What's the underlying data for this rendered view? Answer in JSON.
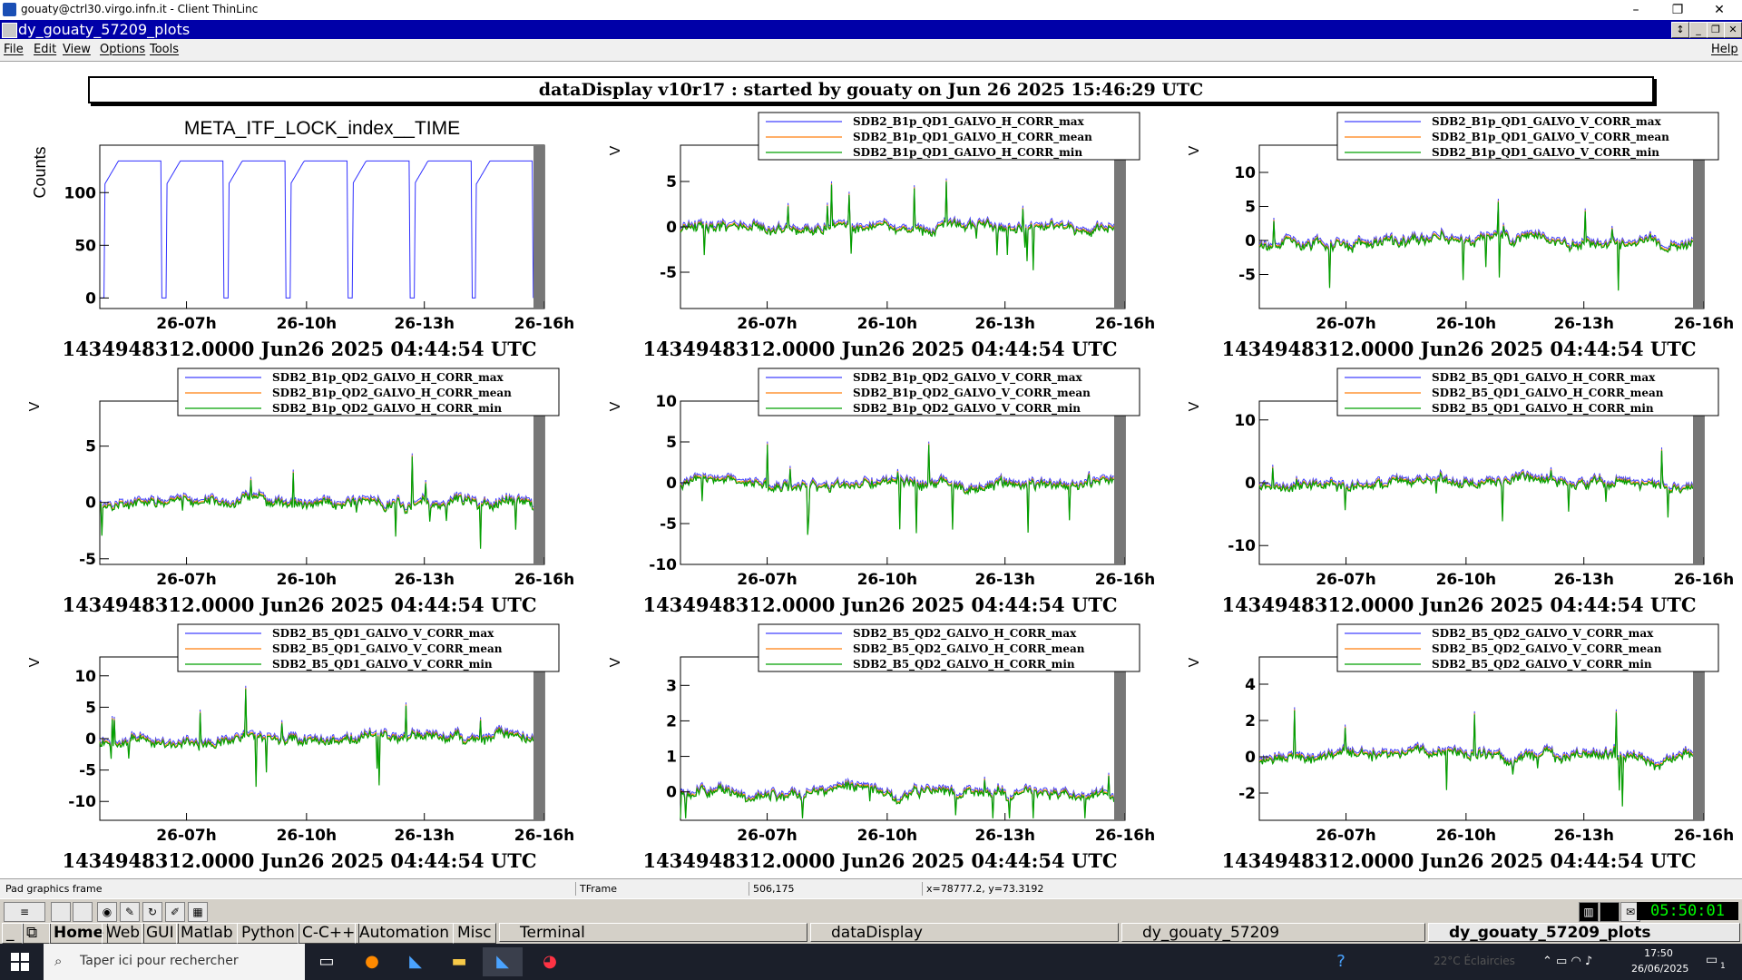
{
  "outer_window": {
    "title": "gouaty@ctrl30.virgo.infn.it - Client ThinLinc",
    "minimize": "–",
    "restore": "❐",
    "close": "✕"
  },
  "inner_window": {
    "title": "dy_gouaty_57209_plots"
  },
  "menu": {
    "file": "File",
    "edit": "Edit",
    "view": "View",
    "options": "Options",
    "tools": "Tools",
    "help": "Help"
  },
  "banner": "dataDisplay v10r17 : started by gouaty on Jun 26 2025 15:46:29 UTC",
  "footer_time": "1434948312.0000 Jun26 2025 04:44:54 UTC",
  "x_ticks": [
    "26-07h",
    "26-10h",
    "26-13h",
    "26-16h"
  ],
  "plots": [
    {
      "title": "META_ITF_LOCK_index__TIME",
      "ylabel": "Counts",
      "yticks": [
        {
          "v": 0,
          "t": "0"
        },
        {
          "v": 50,
          "t": "50"
        },
        {
          "v": 100,
          "t": "100"
        }
      ],
      "ylim": [
        -10,
        145
      ],
      "legend": []
    },
    {
      "ylabel": "V",
      "yticks": [
        {
          "v": -5,
          "t": "-5"
        },
        {
          "v": 0,
          "t": "0"
        },
        {
          "v": 5,
          "t": "5"
        }
      ],
      "ylim": [
        -9,
        9
      ],
      "legend": [
        "SDB2_B1p_QD1_GALVO_H_CORR_max",
        "SDB2_B1p_QD1_GALVO_H_CORR_mean",
        "SDB2_B1p_QD1_GALVO_H_CORR_min"
      ]
    },
    {
      "ylabel": "V",
      "yticks": [
        {
          "v": -5,
          "t": "-5"
        },
        {
          "v": 0,
          "t": "0"
        },
        {
          "v": 5,
          "t": "5"
        },
        {
          "v": 10,
          "t": "10"
        }
      ],
      "ylim": [
        -10,
        14
      ],
      "legend": [
        "SDB2_B1p_QD1_GALVO_V_CORR_max",
        "SDB2_B1p_QD1_GALVO_V_CORR_mean",
        "SDB2_B1p_QD1_GALVO_V_CORR_min"
      ]
    },
    {
      "ylabel": "V",
      "yticks": [
        {
          "v": -5,
          "t": "-5"
        },
        {
          "v": 0,
          "t": "0"
        },
        {
          "v": 5,
          "t": "5"
        }
      ],
      "ylim": [
        -5.5,
        9
      ],
      "legend": [
        "SDB2_B1p_QD2_GALVO_H_CORR_max",
        "SDB2_B1p_QD2_GALVO_H_CORR_mean",
        "SDB2_B1p_QD2_GALVO_H_CORR_min"
      ]
    },
    {
      "ylabel": "V",
      "yticks": [
        {
          "v": -10,
          "t": "-10"
        },
        {
          "v": -5,
          "t": "-5"
        },
        {
          "v": 0,
          "t": "0"
        },
        {
          "v": 5,
          "t": "5"
        },
        {
          "v": 10,
          "t": "10"
        }
      ],
      "ylim": [
        -10,
        10
      ],
      "legend": [
        "SDB2_B1p_QD2_GALVO_V_CORR_max",
        "SDB2_B1p_QD2_GALVO_V_CORR_mean",
        "SDB2_B1p_QD2_GALVO_V_CORR_min"
      ]
    },
    {
      "ylabel": "V",
      "yticks": [
        {
          "v": -10,
          "t": "-10"
        },
        {
          "v": 0,
          "t": "0"
        },
        {
          "v": 10,
          "t": "10"
        }
      ],
      "ylim": [
        -13,
        13
      ],
      "legend": [
        "SDB2_B5_QD1_GALVO_H_CORR_max",
        "SDB2_B5_QD1_GALVO_H_CORR_mean",
        "SDB2_B5_QD1_GALVO_H_CORR_min"
      ]
    },
    {
      "ylabel": "V",
      "yticks": [
        {
          "v": -10,
          "t": "-10"
        },
        {
          "v": -5,
          "t": "-5"
        },
        {
          "v": 0,
          "t": "0"
        },
        {
          "v": 5,
          "t": "5"
        },
        {
          "v": 10,
          "t": "10"
        }
      ],
      "ylim": [
        -13,
        13
      ],
      "legend": [
        "SDB2_B5_QD1_GALVO_V_CORR_max",
        "SDB2_B5_QD1_GALVO_V_CORR_mean",
        "SDB2_B5_QD1_GALVO_V_CORR_min"
      ]
    },
    {
      "ylabel": "V",
      "yticks": [
        {
          "v": 0,
          "t": "0"
        },
        {
          "v": 1,
          "t": "1"
        },
        {
          "v": 2,
          "t": "2"
        },
        {
          "v": 3,
          "t": "3"
        }
      ],
      "ylim": [
        -0.8,
        3.8
      ],
      "legend": [
        "SDB2_B5_QD2_GALVO_H_CORR_max",
        "SDB2_B5_QD2_GALVO_H_CORR_mean",
        "SDB2_B5_QD2_GALVO_H_CORR_min"
      ]
    },
    {
      "ylabel": "V",
      "yticks": [
        {
          "v": -2,
          "t": "-2"
        },
        {
          "v": 0,
          "t": "0"
        },
        {
          "v": 2,
          "t": "2"
        },
        {
          "v": 4,
          "t": "4"
        }
      ],
      "ylim": [
        -3.5,
        5.5
      ],
      "legend": [
        "SDB2_B5_QD2_GALVO_V_CORR_max",
        "SDB2_B5_QD2_GALVO_V_CORR_mean",
        "SDB2_B5_QD2_GALVO_V_CORR_min"
      ]
    }
  ],
  "series_colors": {
    "max": "#4040ff",
    "mean": "#ff7f0e",
    "min": "#00a000"
  },
  "status": {
    "f1": "Pad graphics frame",
    "f2": "TFrame",
    "f3": "506,175",
    "f4": "x=78777.2, y=73.3192"
  },
  "app_tabs": [
    "Home",
    "Web",
    "GUI",
    "Matlab",
    "Python",
    "C-C++",
    "Automation",
    "Misc"
  ],
  "tasks": [
    "Terminal",
    "dataDisplay",
    "dy_gouaty_57209",
    "dy_gouaty_57209_plots"
  ],
  "clock": "05:50:01 PM",
  "windows": {
    "search_placeholder": "Taper ici pour rechercher",
    "weather": "22°C Éclaircies",
    "time": "17:50",
    "date": "26/06/2025",
    "notif_count": "1"
  }
}
